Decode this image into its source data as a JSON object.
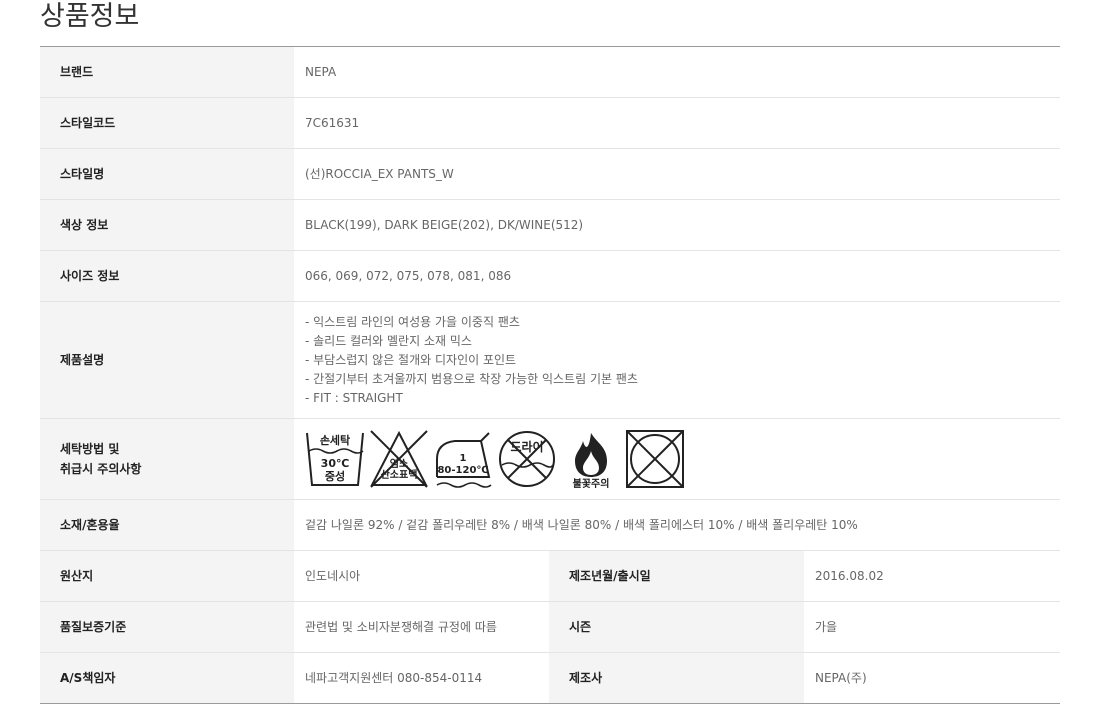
{
  "page": {
    "title": "상품정보"
  },
  "rows": {
    "brand": {
      "label": "브랜드",
      "value": "NEPA"
    },
    "style_code": {
      "label": "스타일코드",
      "value": "7C61631"
    },
    "style_name": {
      "label": "스타일명",
      "value": "(선)ROCCIA_EX PANTS_W"
    },
    "color": {
      "label": "색상 정보",
      "value": "BLACK(199), DARK BEIGE(202), DK/WINE(512)"
    },
    "size": {
      "label": "사이즈 정보",
      "value": "066, 069, 072, 075, 078, 081, 086"
    },
    "description": {
      "label": "제품설명",
      "lines": [
        "- 익스트림 라인의 여성용 가을 이중직 팬츠",
        "- 솔리드 컬러와 멜란지 소재 믹스",
        "- 부담스럽지 않은 절개와 디자인이 포인트",
        "- 간절기부터 초겨울까지 범용으로 착장 가능한 익스트림 기본 팬츠",
        "- FIT : STRAIGHT"
      ]
    },
    "care": {
      "label_line1": "세탁방법 및",
      "label_line2": "취급시 주의사항",
      "icons": [
        {
          "name": "hand-wash-icon",
          "text_top": "손세탁",
          "text_mid": "30℃",
          "text_bot": "중성"
        },
        {
          "name": "no-bleach-icon",
          "text_top": "염소",
          "text_bot": "산소표백"
        },
        {
          "name": "iron-icon",
          "text_top": "1",
          "text_bot": "80-120℃"
        },
        {
          "name": "no-dry-clean-icon",
          "text_top": "드라이"
        },
        {
          "name": "flame-caution-icon",
          "text_bot": "불꽃주의"
        },
        {
          "name": "no-tumble-dry-icon"
        }
      ]
    },
    "material": {
      "label": "소재/혼용율",
      "value": "겉감 나일론 92% / 겉감 폴리우레탄 8% / 배색 나일론 80% / 배색 폴리에스터 10% / 배색 폴리우레탄 10%"
    },
    "origin": {
      "label": "원산지",
      "value": "인도네시아",
      "label2": "제조년월/출시일",
      "value2": "2016.08.02"
    },
    "quality": {
      "label": "품질보증기준",
      "value": "관련법 및 소비자분쟁해결 규정에 따름",
      "label2": "시즌",
      "value2": "가을"
    },
    "as": {
      "label": "A/S책임자",
      "value": "네파고객지원센터 080-854-0114",
      "label2": "제조사",
      "value2": "NEPA(주)"
    }
  }
}
